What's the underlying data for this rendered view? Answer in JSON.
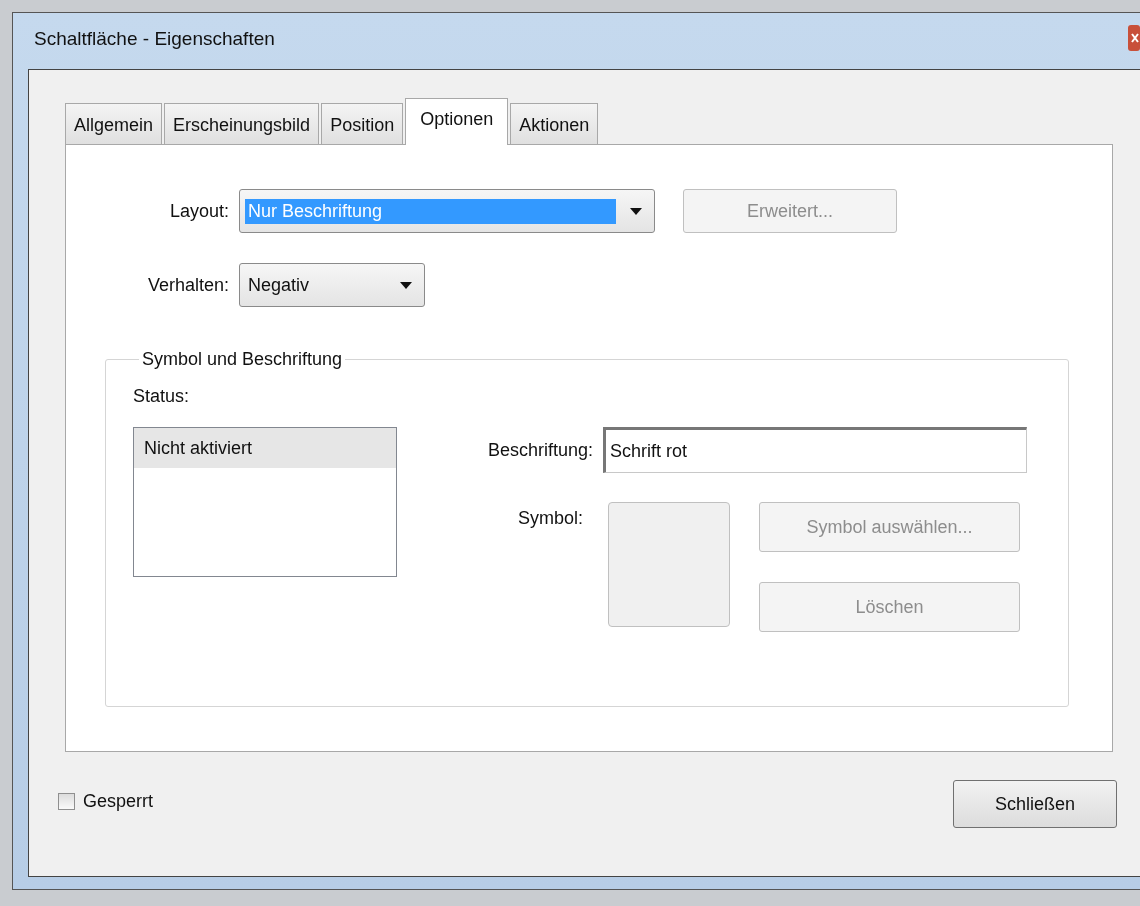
{
  "window": {
    "title": "Schaltfläche - Eigenschaften"
  },
  "tabs": [
    {
      "label": "Allgemein",
      "selected": false
    },
    {
      "label": "Erscheinungsbild",
      "selected": false
    },
    {
      "label": "Position",
      "selected": false
    },
    {
      "label": "Optionen",
      "selected": true
    },
    {
      "label": "Aktionen",
      "selected": false
    }
  ],
  "layout": {
    "label": "Layout:",
    "value": "Nur Beschriftung",
    "focused": true
  },
  "advanced_button": {
    "label": "Erweitert...",
    "disabled": true
  },
  "behavior": {
    "label": "Verhalten:",
    "value": "Negativ",
    "focused": false
  },
  "group": {
    "title": "Symbol und Beschriftung",
    "status_label": "Status:",
    "status_items": [
      {
        "label": "Nicht aktiviert",
        "selected": true
      }
    ],
    "caption": {
      "label": "Beschriftung:",
      "value": "Schrift rot"
    },
    "symbol_label": "Symbol:",
    "buttons": [
      {
        "label": "Symbol auswählen...",
        "disabled": true
      },
      {
        "label": "Löschen",
        "disabled": true
      }
    ]
  },
  "locked": {
    "label": "Gesperrt",
    "checked": false
  },
  "close_button": {
    "label": "Schließen",
    "disabled": false
  }
}
